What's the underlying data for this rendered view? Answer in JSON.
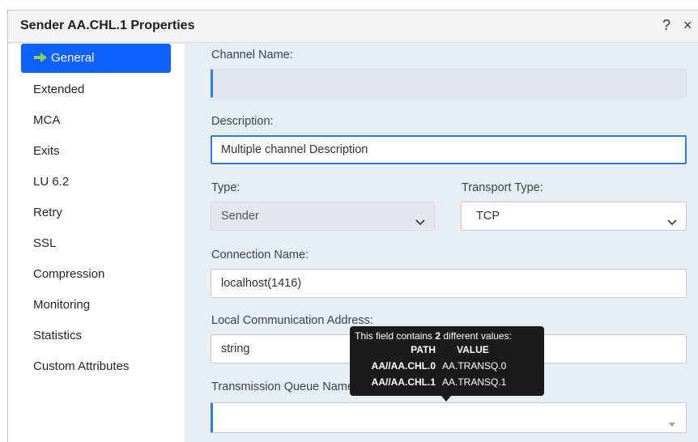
{
  "dialog": {
    "title": "Sender AA.CHL.1 Properties",
    "help_label": "?",
    "close_label": "×"
  },
  "sidebar": {
    "items": [
      {
        "label": "General",
        "active": true
      },
      {
        "label": "Extended"
      },
      {
        "label": "MCA"
      },
      {
        "label": "Exits"
      },
      {
        "label": "LU 6.2"
      },
      {
        "label": "Retry"
      },
      {
        "label": "SSL"
      },
      {
        "label": "Compression"
      },
      {
        "label": "Monitoring"
      },
      {
        "label": "Statistics"
      },
      {
        "label": "Custom Attributes"
      }
    ]
  },
  "form": {
    "channel_name_label": "Channel Name:",
    "channel_name_value": "",
    "description_label": "Description:",
    "description_value": "Multiple channel Description",
    "type_label": "Type:",
    "type_value": "Sender",
    "transport_label": "Transport Type:",
    "transport_value": "TCP",
    "connection_label": "Connection Name:",
    "connection_value": "localhost(1416)",
    "local_addr_label": "Local Communication Address:",
    "local_addr_value": "string",
    "xmitq_label": "Transmission Queue Name:",
    "xmitq_value": ""
  },
  "tooltip": {
    "header_prefix": "This field contains ",
    "header_count": "2",
    "header_suffix": " different values:",
    "col_path": "PATH",
    "col_value": "VALUE",
    "rows": [
      {
        "path": "AA//AA.CHL.0",
        "value": "AA.TRANSQ.0"
      },
      {
        "path": "AA//AA.CHL.1",
        "value": "AA.TRANSQ.1"
      }
    ]
  },
  "colors": {
    "accent": "#0f62fe",
    "focus": "#2a7de1",
    "tooltip_bg": "#1b1b1b",
    "arrow_icon": "#8fd14f"
  }
}
